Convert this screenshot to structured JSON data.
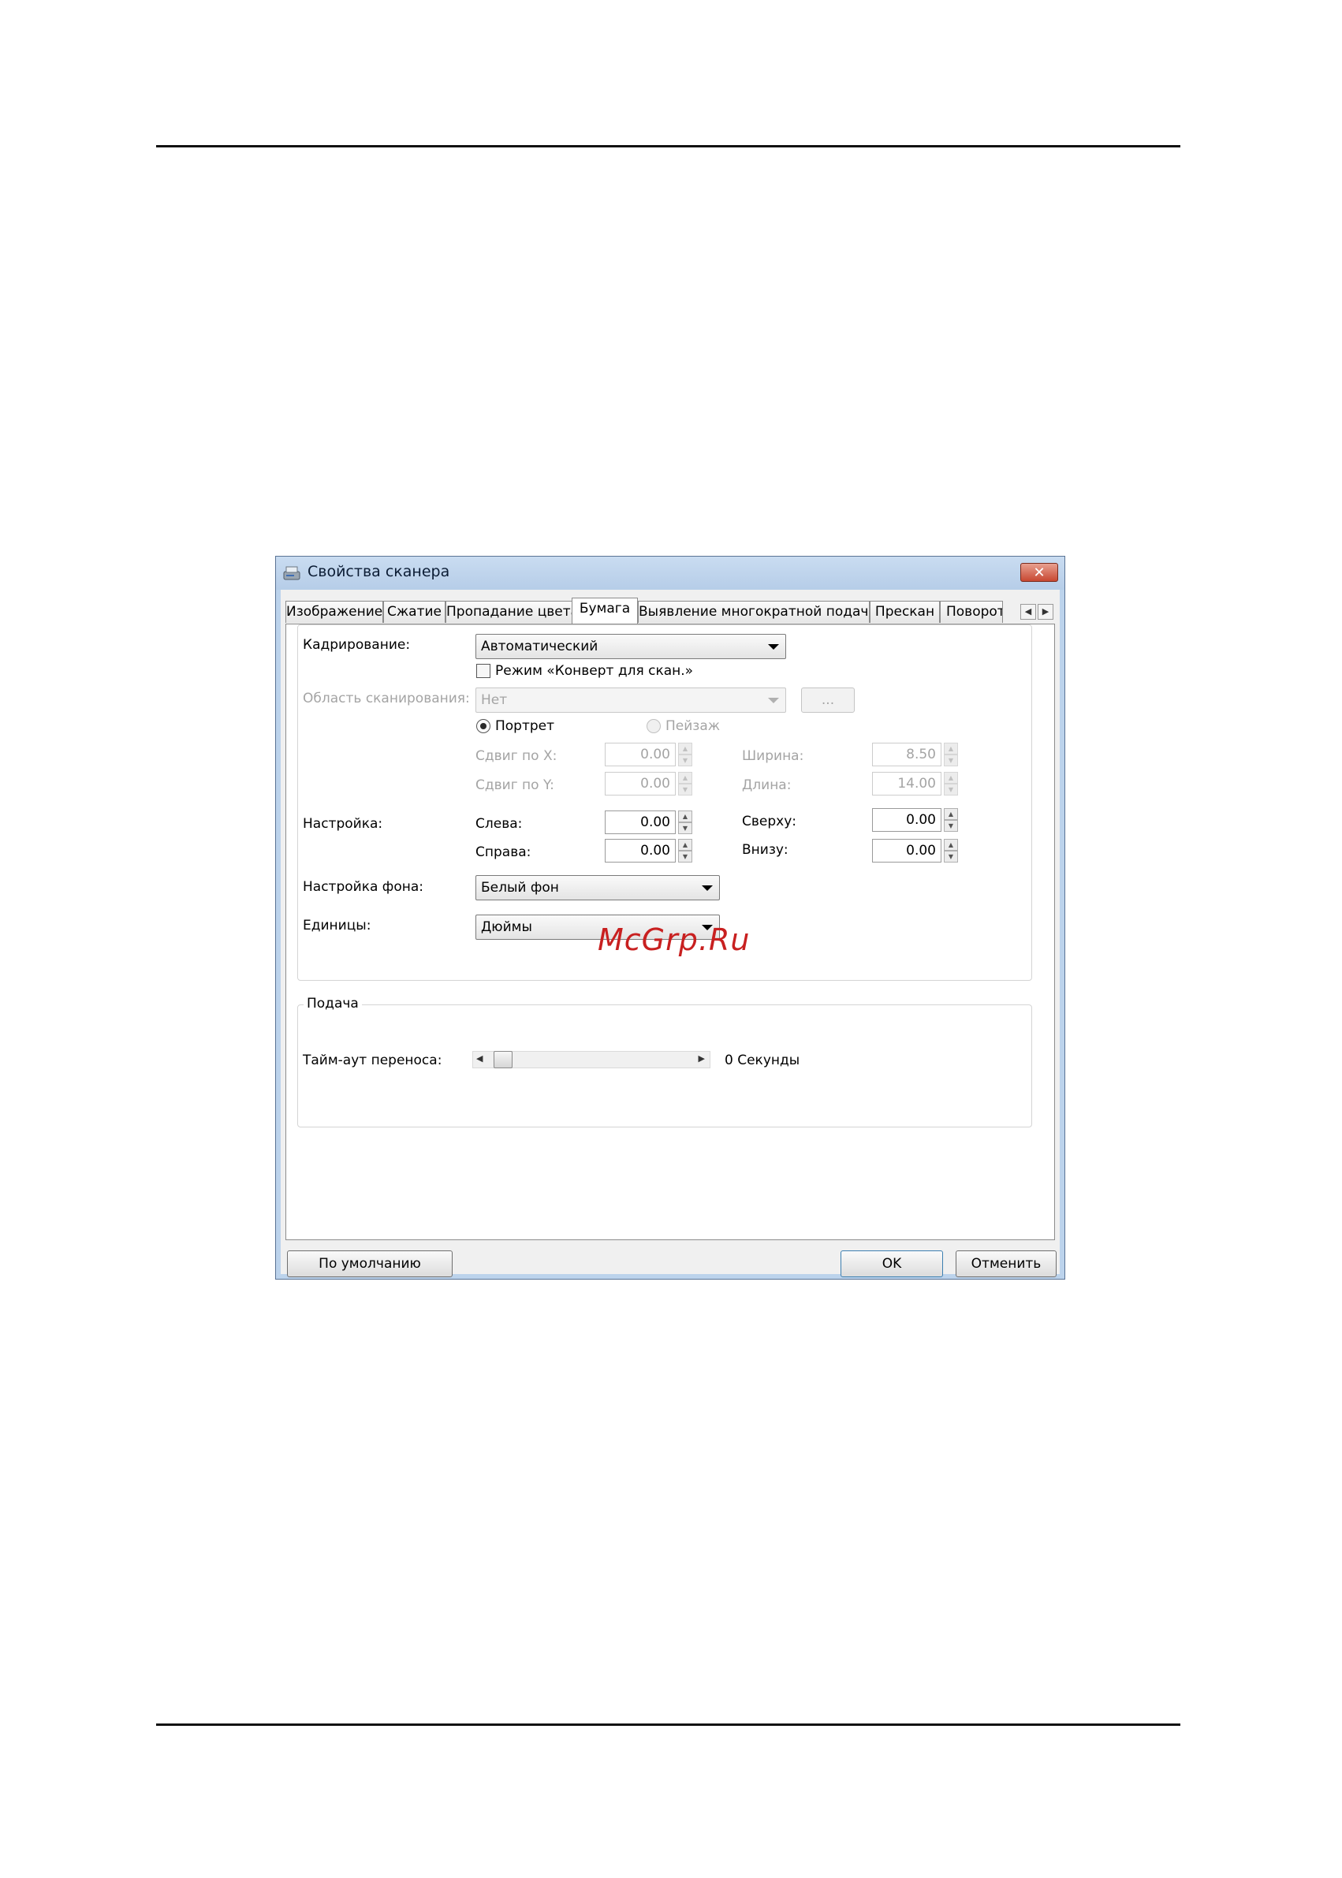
{
  "dialog": {
    "title": "Свойства сканера",
    "close_label": "✕",
    "tabs": [
      {
        "label": "Изображение",
        "active": false
      },
      {
        "label": "Сжатие",
        "active": false
      },
      {
        "label": "Пропадание цвета",
        "active": false
      },
      {
        "label": "Бумага",
        "active": true
      },
      {
        "label": "Выявление многократной подачи",
        "active": false
      },
      {
        "label": "Прескан",
        "active": false
      },
      {
        "label": "Поворот",
        "active": false
      }
    ],
    "tab_scroll": {
      "left": "◀",
      "right": "▶"
    },
    "paper": {
      "cropping": {
        "label": "Кадрирование:",
        "value": "Автоматический"
      },
      "envelope_mode": {
        "label": "Режим «Конверт для скан.»",
        "checked": false
      },
      "scan_area": {
        "label": "Область сканирования:",
        "value": "Нет",
        "browse_label": "...",
        "enabled": false
      },
      "orientation": {
        "portrait_label": "Портрет",
        "landscape_label": "Пейзаж",
        "selected": "Портрет"
      },
      "offset_x": {
        "label": "Сдвиг по X:",
        "value": "0.00"
      },
      "offset_y": {
        "label": "Сдвиг по Y:",
        "value": "0.00"
      },
      "width": {
        "label": "Ширина:",
        "value": "8.50"
      },
      "length": {
        "label": "Длина:",
        "value": "14.00"
      },
      "adjust": {
        "label": "Настройка:",
        "left": {
          "label": "Слева:",
          "value": "0.00"
        },
        "right": {
          "label": "Справа:",
          "value": "0.00"
        },
        "top": {
          "label": "Сверху:",
          "value": "0.00"
        },
        "bottom": {
          "label": "Внизу:",
          "value": "0.00"
        }
      },
      "background": {
        "label": "Настройка фона:",
        "value": "Белый фон"
      },
      "units": {
        "label": "Единицы:",
        "value": "Дюймы"
      }
    },
    "feed": {
      "group_label": "Подача",
      "timeout_label": "Тайм-аут переноса:",
      "timeout_value": "0 Секунды",
      "timeout_level": 0
    },
    "buttons": {
      "default": "По умолчанию",
      "ok": "OK",
      "cancel": "Отменить"
    }
  },
  "watermark": "McGrp.Ru"
}
